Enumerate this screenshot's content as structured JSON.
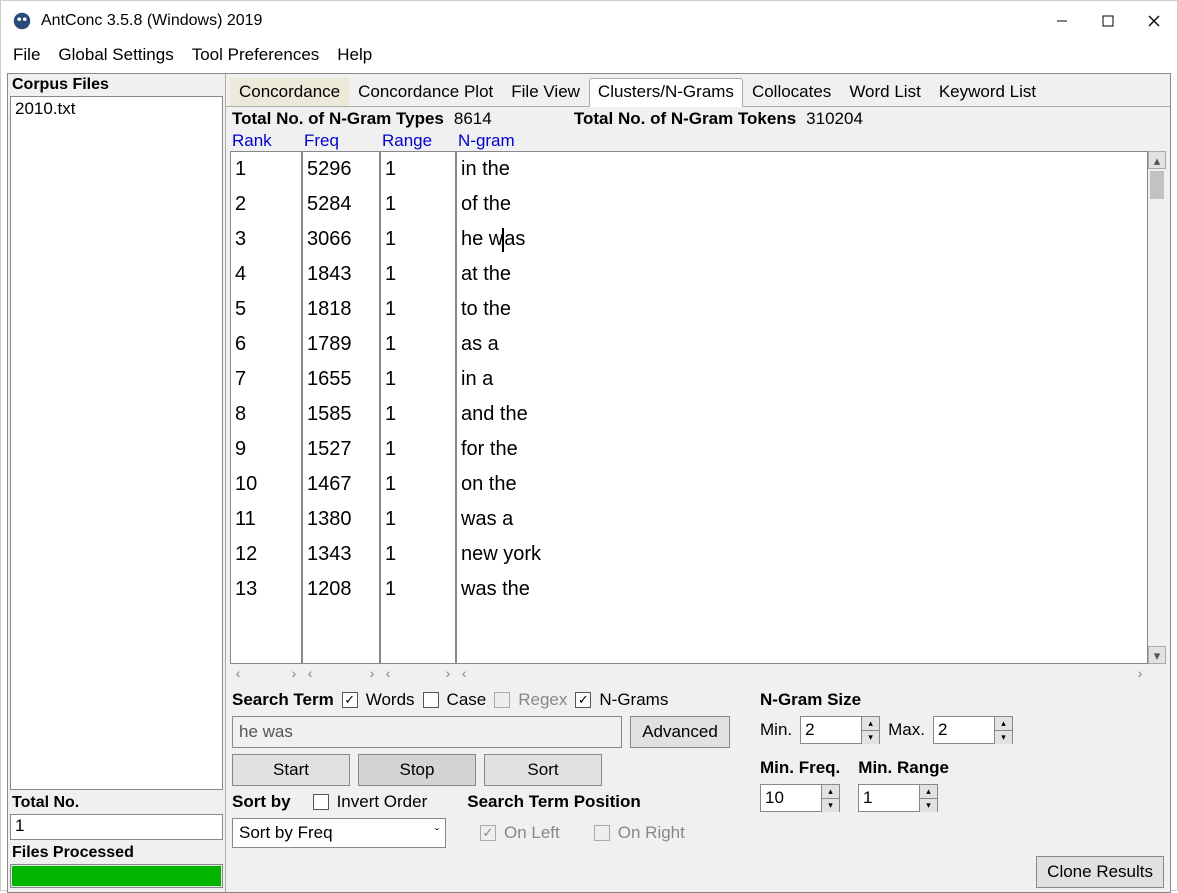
{
  "window": {
    "title": "AntConc 3.5.8 (Windows) 2019"
  },
  "menubar": [
    "File",
    "Global Settings",
    "Tool Preferences",
    "Help"
  ],
  "left": {
    "corpus_files_label": "Corpus Files",
    "corpus_files": [
      "2010.txt"
    ],
    "total_no_label": "Total No.",
    "total_no": "1",
    "files_processed_label": "Files Processed"
  },
  "tabs": [
    "Concordance",
    "Concordance Plot",
    "File View",
    "Clusters/N-Grams",
    "Collocates",
    "Word List",
    "Keyword List"
  ],
  "active_tab_index": 3,
  "stats": {
    "types_label": "Total No. of N-Gram Types",
    "types_value": "8614",
    "tokens_label": "Total No. of N-Gram Tokens",
    "tokens_value": "310204"
  },
  "headers": {
    "rank": "Rank",
    "freq": "Freq",
    "range": "Range",
    "ngram": "N-gram"
  },
  "rows": [
    {
      "rank": "1",
      "freq": "5296",
      "range": "1",
      "ngram": "in the"
    },
    {
      "rank": "2",
      "freq": "5284",
      "range": "1",
      "ngram": "of the"
    },
    {
      "rank": "3",
      "freq": "3066",
      "range": "1",
      "ngram": "he was",
      "cursor_after": 4
    },
    {
      "rank": "4",
      "freq": "1843",
      "range": "1",
      "ngram": "at the"
    },
    {
      "rank": "5",
      "freq": "1818",
      "range": "1",
      "ngram": "to the"
    },
    {
      "rank": "6",
      "freq": "1789",
      "range": "1",
      "ngram": "as a"
    },
    {
      "rank": "7",
      "freq": "1655",
      "range": "1",
      "ngram": "in a"
    },
    {
      "rank": "8",
      "freq": "1585",
      "range": "1",
      "ngram": "and the"
    },
    {
      "rank": "9",
      "freq": "1527",
      "range": "1",
      "ngram": "for the"
    },
    {
      "rank": "10",
      "freq": "1467",
      "range": "1",
      "ngram": "on the"
    },
    {
      "rank": "11",
      "freq": "1380",
      "range": "1",
      "ngram": "was a"
    },
    {
      "rank": "12",
      "freq": "1343",
      "range": "1",
      "ngram": "new york"
    },
    {
      "rank": "13",
      "freq": "1208",
      "range": "1",
      "ngram": "was the"
    }
  ],
  "search": {
    "label": "Search Term",
    "words_label": "Words",
    "case_label": "Case",
    "regex_label": "Regex",
    "ngrams_label": "N-Grams",
    "value": "he was",
    "advanced_label": "Advanced",
    "start_label": "Start",
    "stop_label": "Stop",
    "sort_label": "Sort"
  },
  "sort": {
    "label": "Sort by",
    "invert_label": "Invert Order",
    "value": "Sort by Freq",
    "position_label": "Search Term Position",
    "on_left_label": "On Left",
    "on_right_label": "On Right"
  },
  "ngram_size": {
    "label": "N-Gram Size",
    "min_label": "Min.",
    "min_value": "2",
    "max_label": "Max.",
    "max_value": "2"
  },
  "min_params": {
    "freq_label": "Min. Freq.",
    "range_label": "Min. Range",
    "freq_value": "10",
    "range_value": "1"
  },
  "clone_label": "Clone Results"
}
